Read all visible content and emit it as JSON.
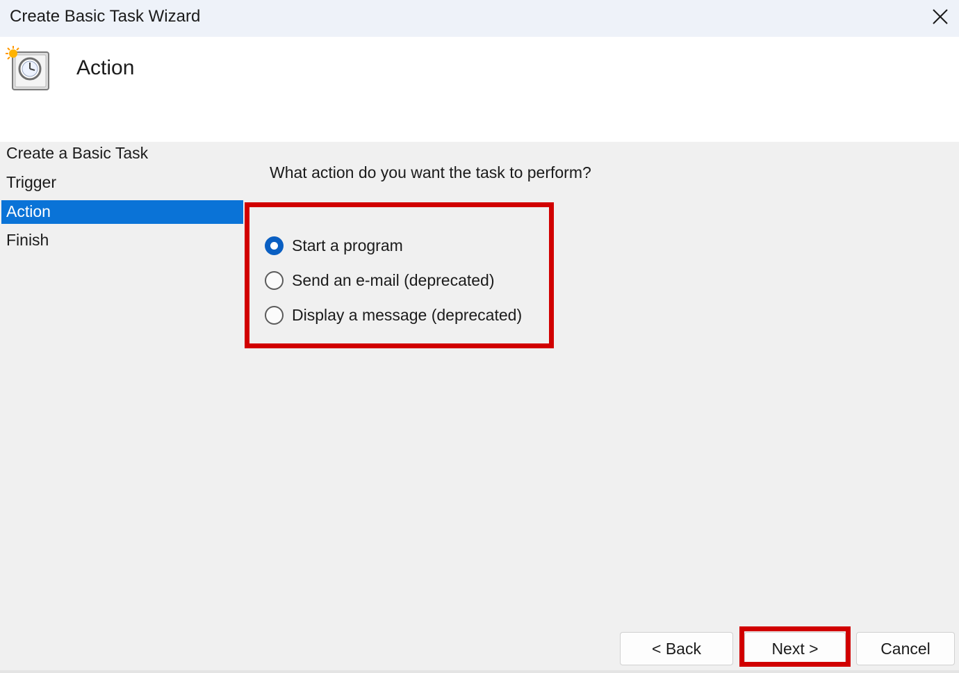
{
  "window": {
    "title": "Create Basic Task Wizard"
  },
  "header": {
    "icon": "task-scheduler-clock-icon",
    "title": "Action"
  },
  "steps": [
    {
      "label": "Create a Basic Task",
      "active": false
    },
    {
      "label": "Trigger",
      "active": false
    },
    {
      "label": "Action",
      "active": true
    },
    {
      "label": "Finish",
      "active": false
    }
  ],
  "main": {
    "question": "What action do you want the task to perform?",
    "options": [
      {
        "label": "Start a program",
        "checked": true
      },
      {
        "label": "Send an e-mail (deprecated)",
        "checked": false
      },
      {
        "label": "Display a message (deprecated)",
        "checked": false
      }
    ]
  },
  "buttons": {
    "back": "< Back",
    "next": "Next >",
    "cancel": "Cancel"
  },
  "colors": {
    "selected_step": "#0a73d7",
    "radio_checked": "#0a5fc2",
    "highlight": "#d10000"
  }
}
